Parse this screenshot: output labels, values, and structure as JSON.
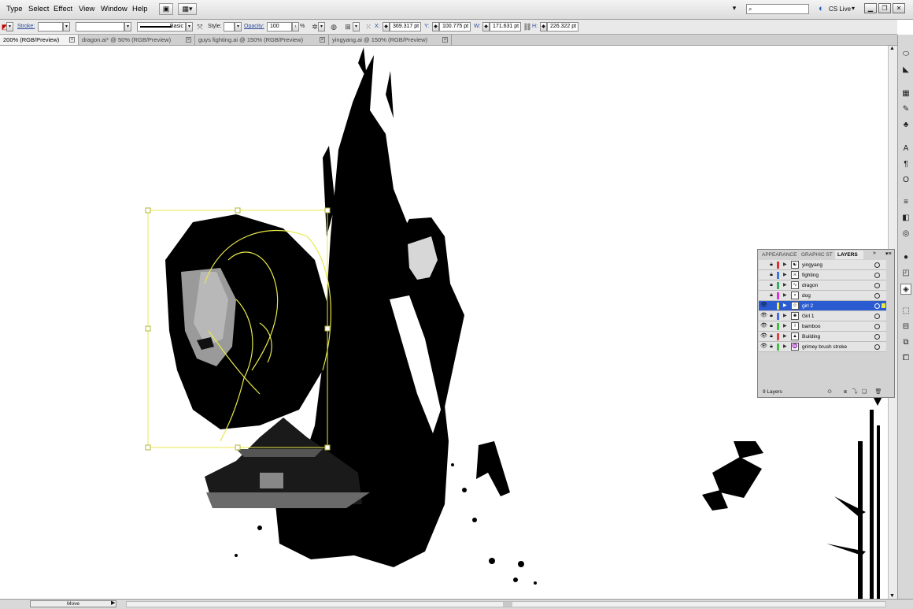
{
  "menubar": {
    "items": [
      "Type",
      "Select",
      "Effect",
      "View",
      "Window",
      "Help"
    ],
    "search": {
      "placeholder": ""
    },
    "cs_live": "CS Live"
  },
  "controlbar": {
    "stroke_label": "Stroke:",
    "stroke_value": "",
    "brush_label": "Basic",
    "style_label": "Style:",
    "opacity_label": "Opacity:",
    "opacity_value": "100",
    "opacity_unit": "%",
    "x_label": "X:",
    "x_value": "369.317 pt",
    "y_label": "Y:",
    "y_value": "100.775 pt",
    "w_label": "W:",
    "w_value": "171.631 pt",
    "h_label": "H:",
    "h_value": "226.322 pt"
  },
  "tabs": [
    {
      "label": "200% (RGB/Preview)",
      "active": true
    },
    {
      "label": "dragon.ai* @ 50% (RGB/Preview)",
      "active": false
    },
    {
      "label": "guys fighting.ai @ 150% (RGB/Preview)",
      "active": false
    },
    {
      "label": "yingyang.ai @ 150% (RGB/Preview)",
      "active": false
    }
  ],
  "layers_panel": {
    "tabs": [
      "APPEARANCE",
      "GRAPHIC ST",
      "LAYERS"
    ],
    "layers": [
      {
        "name": "yingyang",
        "color": "#e03030",
        "visible": false,
        "selected": false
      },
      {
        "name": "fighting",
        "color": "#3a7ae0",
        "visible": false,
        "selected": false
      },
      {
        "name": "dragon",
        "color": "#30b060",
        "visible": false,
        "selected": false
      },
      {
        "name": "dog",
        "color": "#e030e0",
        "visible": false,
        "selected": false
      },
      {
        "name": "girl 2",
        "color": "#e8e84a",
        "visible": true,
        "selected": true
      },
      {
        "name": "Girl 1",
        "color": "#4a6ae0",
        "visible": true,
        "selected": false
      },
      {
        "name": "bamboo",
        "color": "#40c040",
        "visible": true,
        "selected": false
      },
      {
        "name": "Building",
        "color": "#e04040",
        "visible": true,
        "selected": false
      },
      {
        "name": "grimey brush stroke",
        "color": "#40c040",
        "visible": true,
        "selected": false
      }
    ],
    "layer_count": "9 Layers"
  },
  "statusbar": {
    "tool": "Move"
  },
  "colors": {
    "selection": "#e8e84a",
    "highlight": "#2a5bd0"
  }
}
